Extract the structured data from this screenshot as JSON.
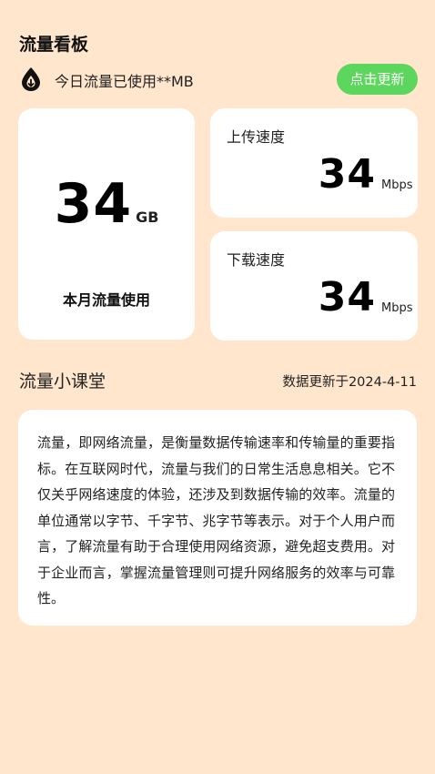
{
  "header": {
    "title": "流量看板",
    "usage_text": "今日流量已使用**MB",
    "refresh_label": "点击更新",
    "drop_icon": "water-drop-icon"
  },
  "month_card": {
    "value": "34",
    "unit": "GB",
    "label": "本月流量使用"
  },
  "upload_card": {
    "label": "上传速度",
    "value": "34",
    "unit": "Mbps"
  },
  "download_card": {
    "label": "下载速度",
    "value": "34",
    "unit": "Mbps"
  },
  "lesson": {
    "title": "流量小课堂",
    "update_date": "数据更新于2024-4-11",
    "body": "流量，即网络流量，是衡量数据传输速率和传输量的重要指标。在互联网时代，流量与我们的日常生活息息相关。它不仅关乎网络速度的体验，还涉及到数据传输的效率。流量的单位通常以字节、千字节、兆字节等表示。对于个人用户而言，了解流量有助于合理使用网络资源，避免超支费用。对于企业而言，掌握流量管理则可提升网络服务的效率与可靠性。"
  },
  "colors": {
    "background": "#FFE6CC",
    "card": "#FFFFFF",
    "button": "#5CD65C"
  }
}
